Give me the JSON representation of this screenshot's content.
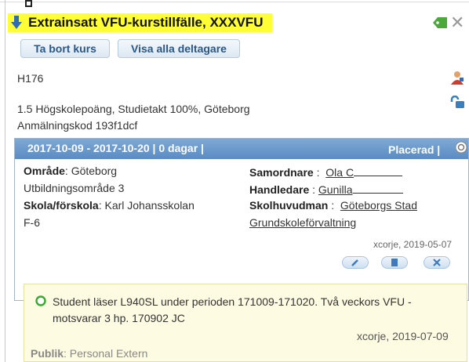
{
  "header": {
    "title": "Extrainsatt VFU-kurstillfälle, XXXVFU",
    "icons": [
      "arrow-down-icon",
      "tag-icon",
      "close-icon"
    ]
  },
  "toolbar": {
    "remove_label": "Ta bort kurs",
    "show_all_label": "Visa alla deltagare"
  },
  "course": {
    "code": "H176",
    "details": "1.5 Högskolepoäng, Studietakt 100%, Göteborg",
    "registration": "Anmälningskod 193f1dcf"
  },
  "placement": {
    "date_range": "2017-10-09 - 2017-10-20 | 0 dagar |",
    "status": "Placerad |",
    "area_label": "Område",
    "area_value": ": Göteborg",
    "area_line2": "Utbildningsområde 3",
    "school_label": "Skola/förskola",
    "school_value": ": Karl Johansskolan",
    "school_line2": "F-6",
    "coordinator_label": "Samordnare",
    "coordinator_value": "Ola C",
    "supervisor_label": "Handledare",
    "supervisor_value": "Gunilla",
    "principal_label": "Skolhuvudman",
    "principal_value": "Göteborgs Stad",
    "principal_line2": "Grundskoleförvaltning",
    "modified": "xcorje, 2019-05-07"
  },
  "note": {
    "text": "Student läser L940SL under perioden 171009-171020. Två veckors VFU - motsvarar 3 hp. 170902 JC",
    "modified": "xcorje, 2019-07-09",
    "audience_label": "Publik",
    "audience_value": ": Personal Extern"
  },
  "colors": {
    "highlight": "#ffff33",
    "panel_header": "#6b98cc",
    "note_bg": "#fdfbe1",
    "ok_green": "#3aa832"
  }
}
